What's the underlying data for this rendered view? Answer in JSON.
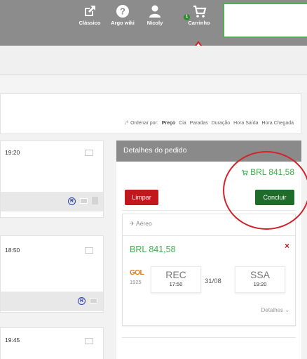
{
  "header": {
    "nav": [
      {
        "label": "Clássico",
        "icon": "external-link-icon"
      },
      {
        "label": "Argo wiki",
        "icon": "help-icon"
      },
      {
        "label": "Nicoly",
        "icon": "user-icon"
      },
      {
        "label": "Carrinho",
        "icon": "cart-icon",
        "badge": "1"
      }
    ]
  },
  "sort": {
    "label": "Ordenar por:",
    "options": [
      "Preço",
      "Cia",
      "Paradas",
      "Duração",
      "Hora Saída",
      "Hora Chegada"
    ],
    "active": "Preço"
  },
  "flight_cards": [
    {
      "time": "19:20"
    },
    {
      "time": "18:50"
    },
    {
      "time": "19:45"
    }
  ],
  "order": {
    "title": "Detalhes do pedido",
    "total": "BRL 841,58",
    "clear_label": "Limpar",
    "conclude_label": "Concluir",
    "item": {
      "type": "Aéreo",
      "price": "BRL 841,58",
      "remove": "×",
      "airline": "GOL",
      "flight_number": "1925",
      "origin": "REC",
      "departure_time": "17:50",
      "date": "31/08",
      "destination": "SSA",
      "arrival_time": "19:20",
      "details_label": "Detalhes"
    }
  },
  "colors": {
    "header_bg": "#8c8c8c",
    "price_green": "#3fae49",
    "clear_red": "#c0181c",
    "conclude_green": "#1e6b2a",
    "annotation_red": "#d2232a"
  }
}
